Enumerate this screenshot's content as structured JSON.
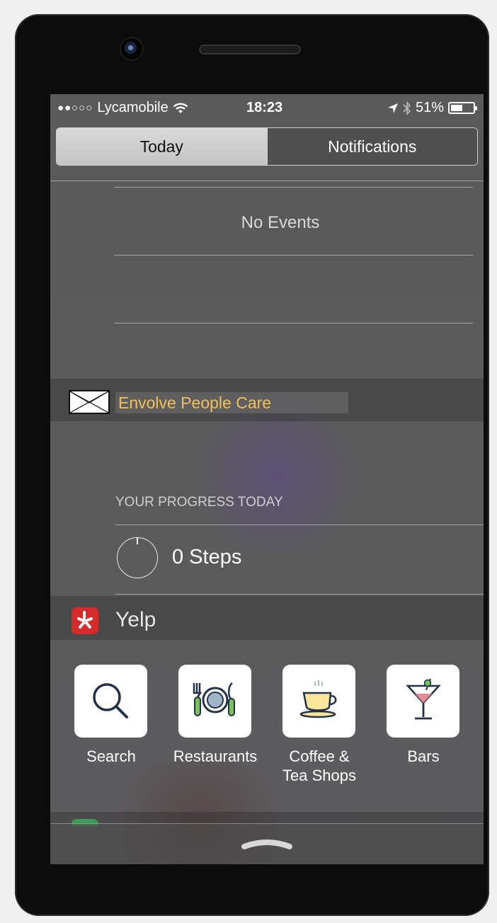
{
  "status_bar": {
    "signal_dots": "●●○○○",
    "carrier": "Lycamobile",
    "time": "18:23",
    "battery": "51%",
    "battery_level": 0.51
  },
  "tabs": [
    {
      "label": "Today",
      "selected": true
    },
    {
      "label": "Notifications",
      "selected": false
    }
  ],
  "calendar": {
    "empty_text": "No Events"
  },
  "envolve_widget": {
    "title": "Envolve People Care",
    "icon": "mail-placeholder-icon",
    "progress_header": "YOUR PROGRESS TODAY",
    "steps_text": "0 Steps"
  },
  "yelp_widget": {
    "title": "Yelp",
    "shortcuts": [
      {
        "label": "Search",
        "icon": "search-icon"
      },
      {
        "label": "Restaurants",
        "icon": "restaurant-icon"
      },
      {
        "label": "Coffee &",
        "label2": "Tea Shops",
        "icon": "coffee-icon"
      },
      {
        "label": "Bars",
        "icon": "cocktail-icon"
      }
    ]
  },
  "colors": {
    "accent_title": "#f2c05a",
    "yelp_red": "#d42b2b"
  }
}
